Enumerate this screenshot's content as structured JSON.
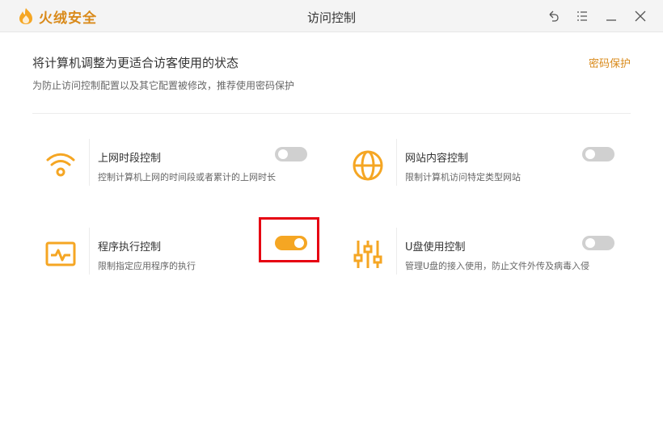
{
  "app": {
    "brand": "火绒安全",
    "window_title": "访问控制",
    "brand_color": "#d98a1a",
    "accent_color": "#f5a623",
    "controls": [
      "undo-icon",
      "menu-icon",
      "minimize-icon",
      "close-icon"
    ]
  },
  "header": {
    "title": "将计算机调整为更适合访客使用的状态",
    "subtitle": "为防止访问控制配置以及其它配置被修改，推荐使用密码保护",
    "password_link": "密码保护"
  },
  "items": [
    {
      "icon": "wifi-icon",
      "title": "上网时段控制",
      "desc": "控制计算机上网的时间段或者累计的上网时长",
      "enabled": false
    },
    {
      "icon": "globe-icon",
      "title": "网站内容控制",
      "desc": "限制计算机访问特定类型网站",
      "enabled": false
    },
    {
      "icon": "monitor-pulse-icon",
      "title": "程序执行控制",
      "desc": "限制指定应用程序的执行",
      "enabled": true
    },
    {
      "icon": "sliders-icon",
      "title": "U盘使用控制",
      "desc": "管理U盘的接入使用，防止文件外传及病毒入侵",
      "enabled": false
    }
  ],
  "highlight_color": "#e60012"
}
